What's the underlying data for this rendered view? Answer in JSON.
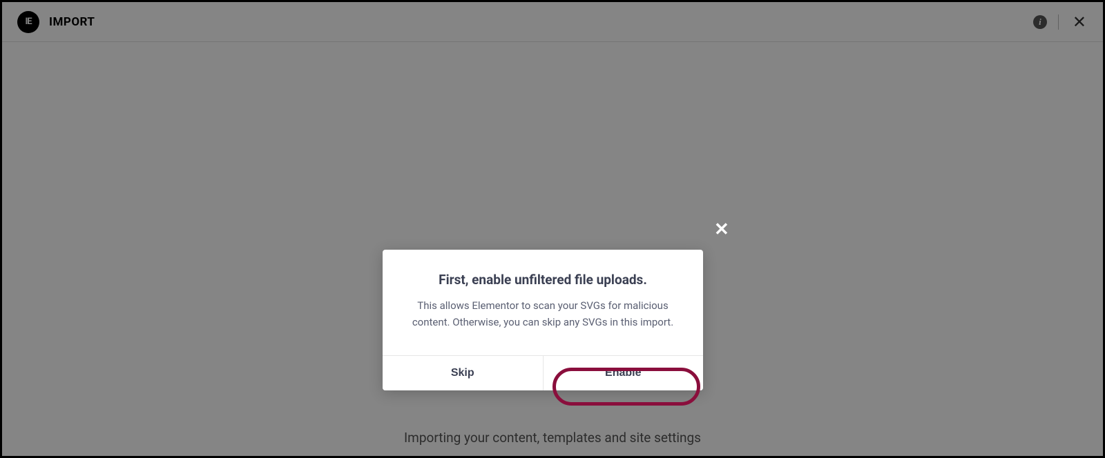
{
  "header": {
    "logo_text": "IE",
    "title": "IMPORT",
    "info_glyph": "i",
    "close_glyph": "✕"
  },
  "background_status": "Importing your content, templates and site settings",
  "modal": {
    "close_glyph": "✕",
    "title": "First, enable unfiltered file uploads.",
    "description": "This allows Elementor to scan your SVGs for malicious content. Otherwise, you can skip any SVGs in this import.",
    "skip_label": "Skip",
    "enable_label": "Enable"
  }
}
